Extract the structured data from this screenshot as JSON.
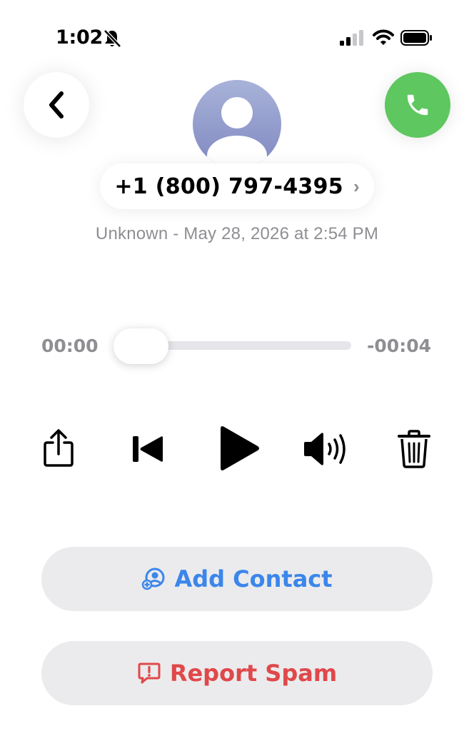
{
  "status_bar": {
    "time": "1:02",
    "icons": [
      "bell-slash-icon",
      "cellular-signal-icon",
      "wifi-icon",
      "battery-icon"
    ]
  },
  "header": {
    "back_icon": "chevron-left-icon",
    "call_icon": "phone-icon",
    "call_color": "#5ec760",
    "avatar_icon": "person-silhouette-icon"
  },
  "caller": {
    "number": "+1 (800) 797-4395",
    "chevron": "›",
    "subtitle": "Unknown - May 28, 2026 at 2:54 PM"
  },
  "player": {
    "elapsed": "00:00",
    "remaining": "-00:04",
    "progress": 0,
    "controls": [
      "share-icon",
      "skip-back-icon",
      "play-icon",
      "speaker-icon",
      "trash-icon"
    ]
  },
  "actions": {
    "add_contact": {
      "label": "Add Contact",
      "icon": "add-contact-icon",
      "color": "#3b86ea"
    },
    "report_spam": {
      "label": "Report Spam",
      "icon": "report-icon",
      "color": "#e0484a"
    }
  }
}
